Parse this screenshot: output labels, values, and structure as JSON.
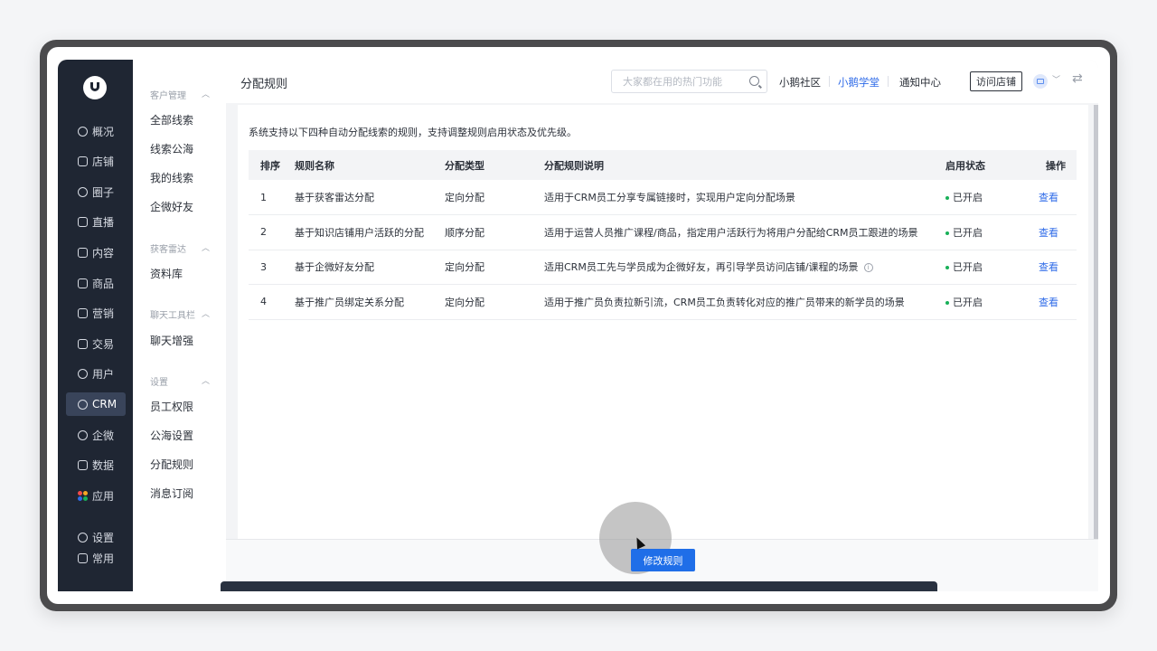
{
  "nav": {
    "items": [
      {
        "label": "概况",
        "icon": "pie-chart-icon"
      },
      {
        "label": "店铺",
        "icon": "store-icon"
      },
      {
        "label": "圈子",
        "icon": "community-icon"
      },
      {
        "label": "直播",
        "icon": "live-icon"
      },
      {
        "label": "内容",
        "icon": "content-icon"
      },
      {
        "label": "商品",
        "icon": "product-icon"
      },
      {
        "label": "营销",
        "icon": "megaphone-icon"
      },
      {
        "label": "交易",
        "icon": "trade-icon"
      },
      {
        "label": "用户",
        "icon": "user-icon"
      },
      {
        "label": "CRM",
        "icon": "crm-icon"
      },
      {
        "label": "企微",
        "icon": "wecom-icon"
      },
      {
        "label": "数据",
        "icon": "data-icon"
      },
      {
        "label": "应用",
        "icon": "apps-icon"
      },
      {
        "label": "设置",
        "icon": "settings-icon"
      },
      {
        "label": "常用",
        "icon": "menu-list-icon"
      }
    ],
    "active": "CRM",
    "app_dot_colors": [
      "#f04a4a",
      "#f5a623",
      "#2f6be8",
      "#18b058"
    ]
  },
  "submenu": {
    "groups": [
      {
        "title": "客户管理",
        "items": [
          "全部线索",
          "线索公海",
          "我的线索",
          "企微好友"
        ]
      },
      {
        "title": "获客雷达",
        "items": [
          "资料库"
        ]
      },
      {
        "title": "聊天工具栏",
        "items": [
          "聊天增强"
        ]
      },
      {
        "title": "设置",
        "items": [
          "员工权限",
          "公海设置",
          "分配规则",
          "消息订阅"
        ]
      }
    ]
  },
  "header": {
    "title": "分配规则",
    "search_placeholder": "大家都在用的热门功能",
    "links": [
      "小鹅社区",
      "小鹅学堂",
      "通知中心"
    ],
    "visit_store": "访问店铺"
  },
  "main": {
    "description": "系统支持以下四种自动分配线索的规则，支持调整规则启用状态及优先级。",
    "columns": [
      "排序",
      "规则名称",
      "分配类型",
      "分配规则说明",
      "启用状态",
      "操作"
    ],
    "rows": [
      {
        "order": "1",
        "name": "基于获客雷达分配",
        "type": "定向分配",
        "desc": "适用于CRM员工分享专属链接时，实现用户定向分配场景",
        "status": "已开启",
        "action": "查看"
      },
      {
        "order": "2",
        "name": "基于知识店铺用户活跃的分配",
        "type": "顺序分配",
        "desc": "适用于运营人员推广课程/商品，指定用户活跃行为将用户分配给CRM员工跟进的场景",
        "status": "已开启",
        "action": "查看"
      },
      {
        "order": "3",
        "name": "基于企微好友分配",
        "type": "定向分配",
        "desc": "适用CRM员工先与学员成为企微好友，再引导学员访问店铺/课程的场景",
        "status": "已开启",
        "action": "查看"
      },
      {
        "order": "4",
        "name": "基于推广员绑定关系分配",
        "type": "定向分配",
        "desc": "适用于推广员负责拉新引流，CRM员工负责转化对应的推广员带来的新学员的场景",
        "status": "已开启",
        "action": "查看"
      }
    ],
    "status_color": "#18b058"
  },
  "footer": {
    "modify_button": "修改规则"
  }
}
